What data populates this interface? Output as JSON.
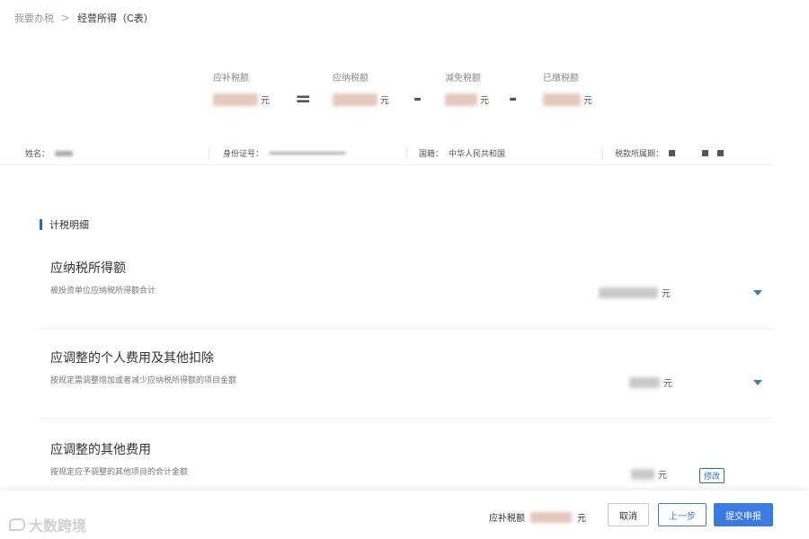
{
  "breadcrumb": {
    "parent": "我要办税",
    "separator": ">",
    "current": "经营所得（C表）"
  },
  "formula": {
    "items": [
      {
        "label": "应补税额",
        "unit": "元"
      },
      {
        "label": "应纳税额",
        "unit": "元"
      },
      {
        "label": "减免税额",
        "unit": "元"
      },
      {
        "label": "已缴税额",
        "unit": "元"
      }
    ],
    "operators": [
      "=",
      "-",
      "-"
    ]
  },
  "info": {
    "name_label": "姓名：",
    "id_label": "身份证号：",
    "nationality_label": "国籍：",
    "nationality_value": "中华人民共和国",
    "period_label": "税款所属期："
  },
  "section": {
    "title": "计税明细"
  },
  "items": [
    {
      "title": "应纳税所得额",
      "desc": "被投资单位应纳税所得额合计",
      "unit": "元"
    },
    {
      "title": "应调整的个人费用及其他扣除",
      "desc": "按规定需调整增加或者减少应纳税所得额的项目金额",
      "unit": "元"
    },
    {
      "title": "应调整的其他费用",
      "desc": "按规定应予调整的其他项目的合计金额",
      "unit": "元",
      "action": "修改"
    }
  ],
  "footer": {
    "amount_label": "应补税额",
    "amount_unit": "元",
    "cancel": "取消",
    "prev": "上一步",
    "submit": "提交申报"
  },
  "watermark": {
    "text": "大数跨境"
  },
  "colors": {
    "accent": "#3b7ae0",
    "blurred_amount": "#e4c7bd"
  }
}
